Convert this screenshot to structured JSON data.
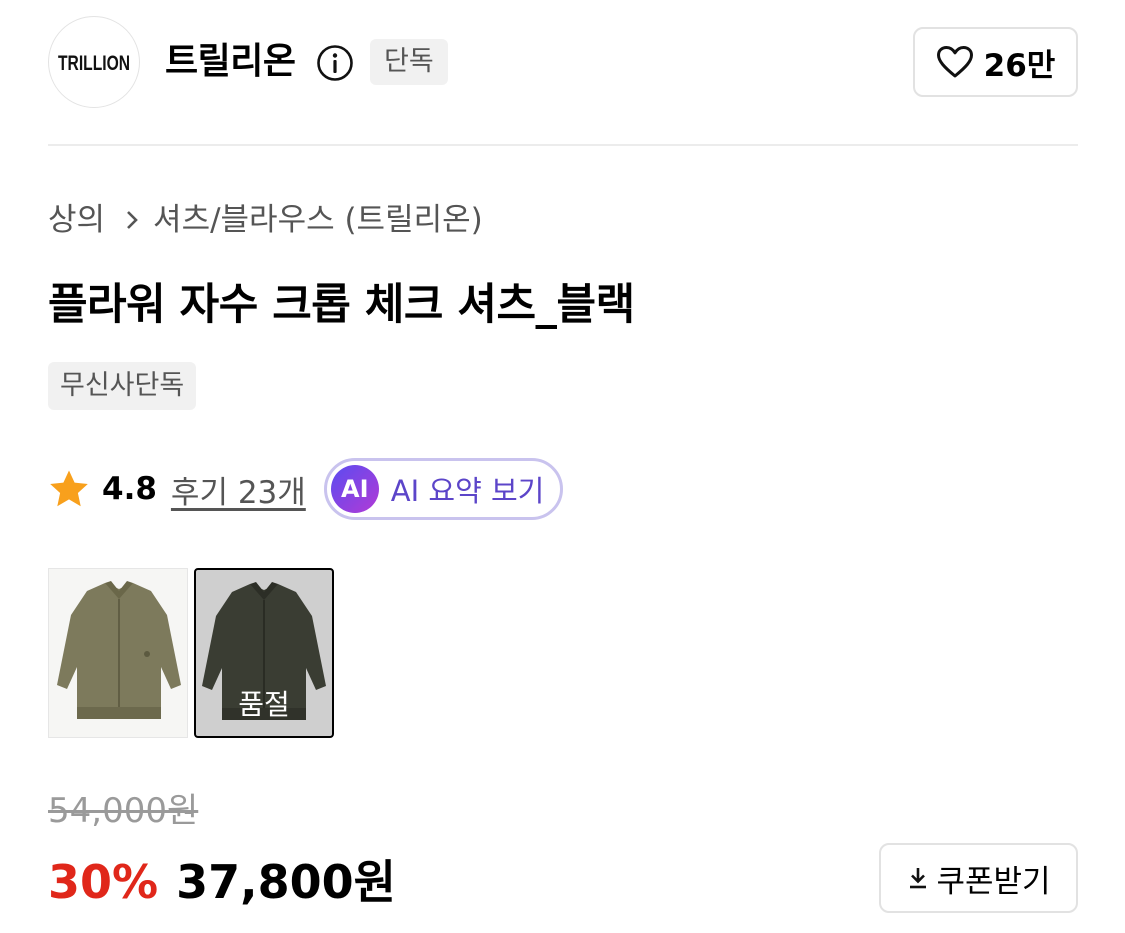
{
  "brand": {
    "logo_text": "TRILLION",
    "name": "트릴리온",
    "exclusive_label": "단독",
    "like_count": "26만"
  },
  "breadcrumb": {
    "category": "상의",
    "subcategory": "셔츠/블라우스 (트릴리온)"
  },
  "product": {
    "title": "플라워 자수 크롭 체크 셔츠_블랙",
    "badge": "무신사단독"
  },
  "rating": {
    "score": "4.8",
    "reviews_label": "후기 23개",
    "ai_badge": "AI",
    "ai_summary_label": "AI 요약 보기"
  },
  "colors": {
    "options": [
      {
        "name": "khaki",
        "selected": false,
        "sold_out": false
      },
      {
        "name": "black",
        "selected": true,
        "sold_out": true
      }
    ],
    "soldout_label": "품절"
  },
  "price": {
    "original": "54,000원",
    "discount": "30%",
    "sale": "37,800원",
    "coupon_label": "쿠폰받기"
  },
  "icons": {
    "info": "info-circle-icon",
    "like": "heart-outline-icon",
    "chevron": "chevron-right-icon",
    "star": "star-filled-icon",
    "download": "download-icon"
  },
  "theme": {
    "discount_color": "#e0271a",
    "star_color": "#f8a01c",
    "ai_accent": "#5c45c9"
  }
}
